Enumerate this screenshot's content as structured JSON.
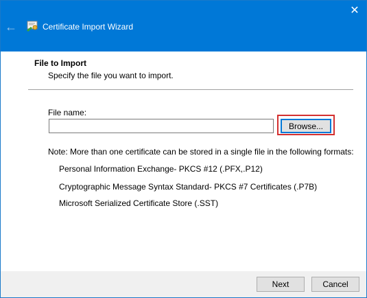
{
  "window": {
    "title": "Certificate Import Wizard",
    "back_icon": "←",
    "close_icon": "✕"
  },
  "page": {
    "heading": "File to Import",
    "subheading": "Specify the file you want to import."
  },
  "file": {
    "label": "File name:",
    "value": "",
    "browse_label": "Browse..."
  },
  "note": "Note:  More than one certificate can be stored in a single file in the following formats:",
  "formats": [
    "Personal Information Exchange- PKCS #12 (.PFX,.P12)",
    "Cryptographic Message Syntax Standard- PKCS #7 Certificates (.P7B)",
    "Microsoft Serialized Certificate Store (.SST)"
  ],
  "footer": {
    "next_label": "Next",
    "cancel_label": "Cancel"
  },
  "colors": {
    "titlebar": "#0078d7",
    "highlight": "#d32f2f"
  }
}
